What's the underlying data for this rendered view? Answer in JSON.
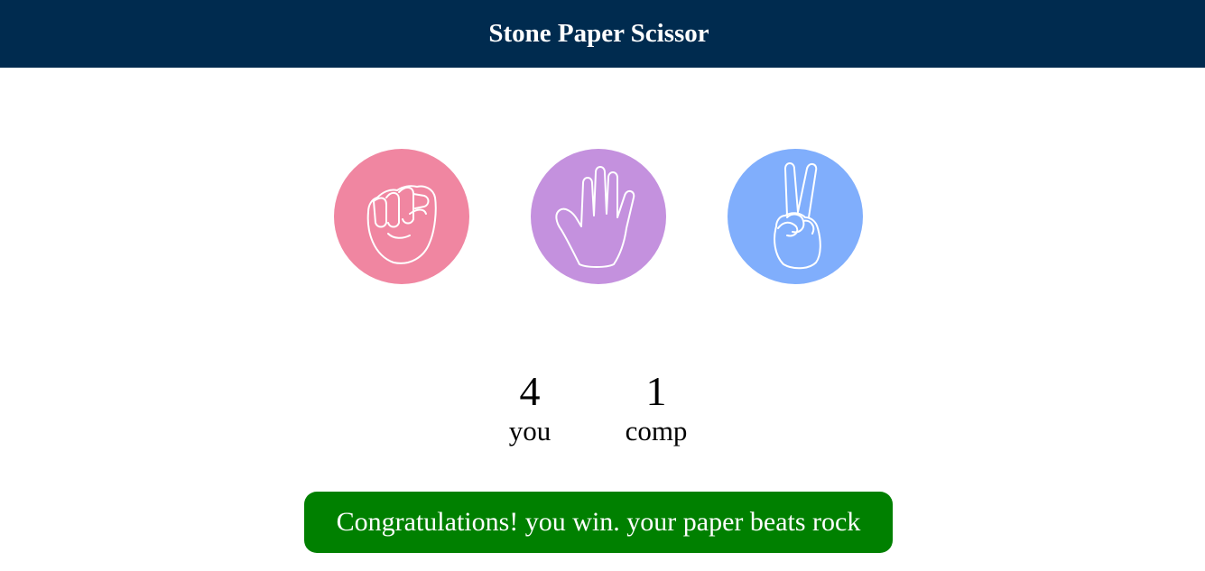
{
  "header": {
    "title": "Stone Paper Scissor"
  },
  "choices": [
    {
      "id": "rock",
      "icon": "fist-icon",
      "color": "#f086a1"
    },
    {
      "id": "paper",
      "icon": "open-hand-icon",
      "color": "#c491de"
    },
    {
      "id": "scissors",
      "icon": "peace-hand-icon",
      "color": "#80aefc"
    }
  ],
  "scoreboard": {
    "user": {
      "score": "4",
      "label": "you"
    },
    "comp": {
      "score": "1",
      "label": "comp"
    }
  },
  "message": {
    "text": "Congratulations! you win. your paper beats rock",
    "color": "#008000"
  },
  "colors": {
    "header_bg": "#002b4f"
  }
}
